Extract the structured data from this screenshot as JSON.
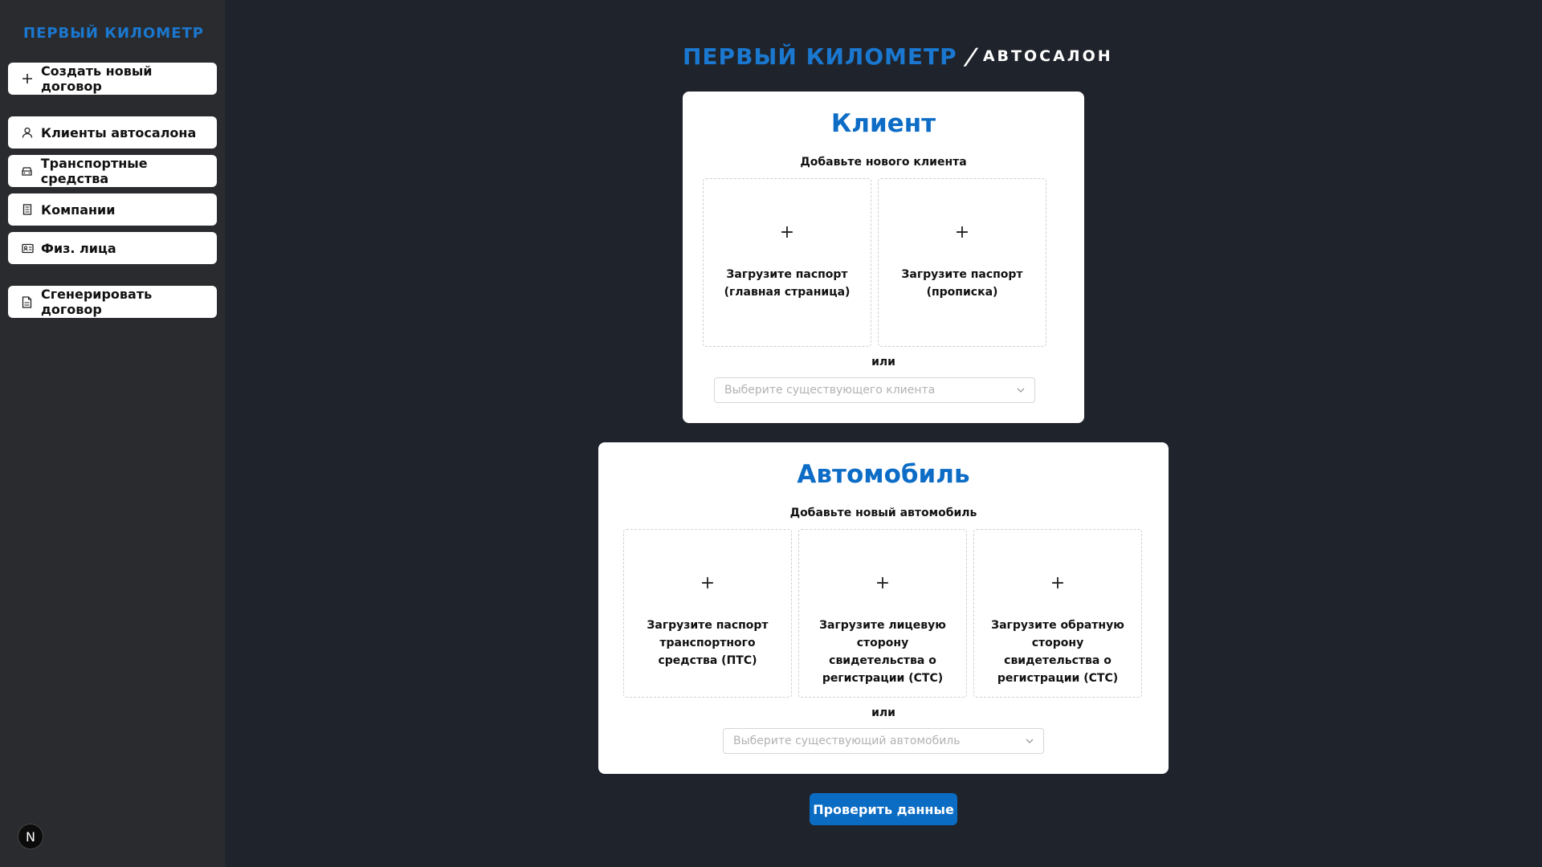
{
  "sidebar": {
    "logo": "ПЕРВЫЙ КИЛОМЕТР",
    "create_contract": "Создать новый договор",
    "items": [
      {
        "label": "Клиенты автосалона",
        "icon": "user-icon"
      },
      {
        "label": "Транспортные средства",
        "icon": "car-icon"
      },
      {
        "label": "Компании",
        "icon": "building-icon"
      },
      {
        "label": "Физ. лица",
        "icon": "id-card-icon"
      }
    ],
    "generate_contract": "Сгенерировать договор",
    "avatar_letter": "N"
  },
  "header": {
    "brand": "ПЕРВЫЙ КИЛОМЕТР",
    "slash": "/",
    "subtitle": "АВТОСАЛОН"
  },
  "client_card": {
    "title": "Клиент",
    "subtitle": "Добавьте нового клиента",
    "uploads": [
      "Загрузите паспорт (главная страница)",
      "Загрузите паспорт (прописка)"
    ],
    "or": "или",
    "select_placeholder": "Выберите существующего клиента"
  },
  "car_card": {
    "title": "Автомобиль",
    "subtitle": "Добавьте новый автомобиль",
    "uploads": [
      "Загрузите паспорт транспортного средства (ПТС)",
      "Загрузите лицевую сторону свидетельства о регистрации (СТС)",
      "Загрузите обратную сторону свидетельства о регистрации (СТС)"
    ],
    "or": "или",
    "select_placeholder": "Выберите существующий автомобиль"
  },
  "actions": {
    "check_data": "Проверить данные"
  },
  "colors": {
    "brand_blue": "#1a78d0",
    "title_blue": "#0c6cc6",
    "button_blue": "#0b6cc4",
    "page_bg": "#1f232b",
    "sidebar_bg": "#2a2b2e"
  }
}
